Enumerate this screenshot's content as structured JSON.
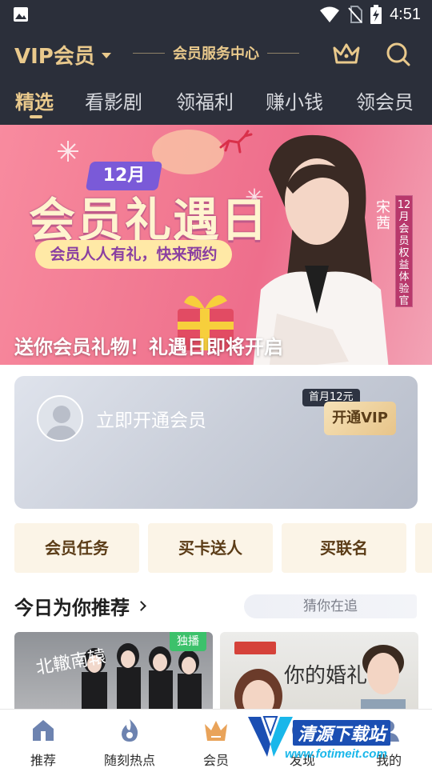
{
  "status_bar": {
    "time": "4:51",
    "icons": [
      "image-icon",
      "wifi-icon",
      "sim-none-icon",
      "battery-charging-icon"
    ]
  },
  "header": {
    "title": "VIP会员",
    "center_title": "会员服务中心",
    "icons": [
      "crown-icon",
      "search-icon"
    ]
  },
  "tabs": [
    {
      "label": "精选",
      "active": true
    },
    {
      "label": "看影剧",
      "active": false
    },
    {
      "label": "领福利",
      "active": false
    },
    {
      "label": "赚小钱",
      "active": false
    },
    {
      "label": "领会员",
      "active": false
    }
  ],
  "banner": {
    "month": "12月",
    "title": "会员礼遇日",
    "subtitle": "会员人人有礼，快来预约",
    "name": "宋茜",
    "side_tag": "12月会员权益体验官",
    "caption": "送你会员礼物！礼遇日即将开启"
  },
  "member_card": {
    "text": "立即开通会员",
    "price_badge": "首月12元",
    "button": "开通VIP"
  },
  "tasks": [
    "会员任务",
    "买卡送人",
    "买联名"
  ],
  "recommend": {
    "title": "今日为你推荐",
    "follow_label": "猜你在追",
    "posters": [
      {
        "title": "北轍南辕",
        "badge": "独播"
      },
      {
        "title": "你的婚礼",
        "badge": ""
      }
    ]
  },
  "bottom_nav": [
    {
      "label": "推荐",
      "icon": "home-icon"
    },
    {
      "label": "随刻热点",
      "icon": "flame-icon"
    },
    {
      "label": "会员",
      "icon": "crown-icon",
      "active": true
    },
    {
      "label": "发现",
      "icon": "discover-icon"
    },
    {
      "label": "我的",
      "icon": "profile-icon"
    }
  ],
  "watermark": {
    "title": "清源下载站",
    "url": "www.fotimeit.com"
  },
  "colors": {
    "header_bg": "#2b2f3a",
    "gold": "#e9c98c",
    "task_bg": "#fbf4e7",
    "badge_green": "#3cc16b"
  }
}
